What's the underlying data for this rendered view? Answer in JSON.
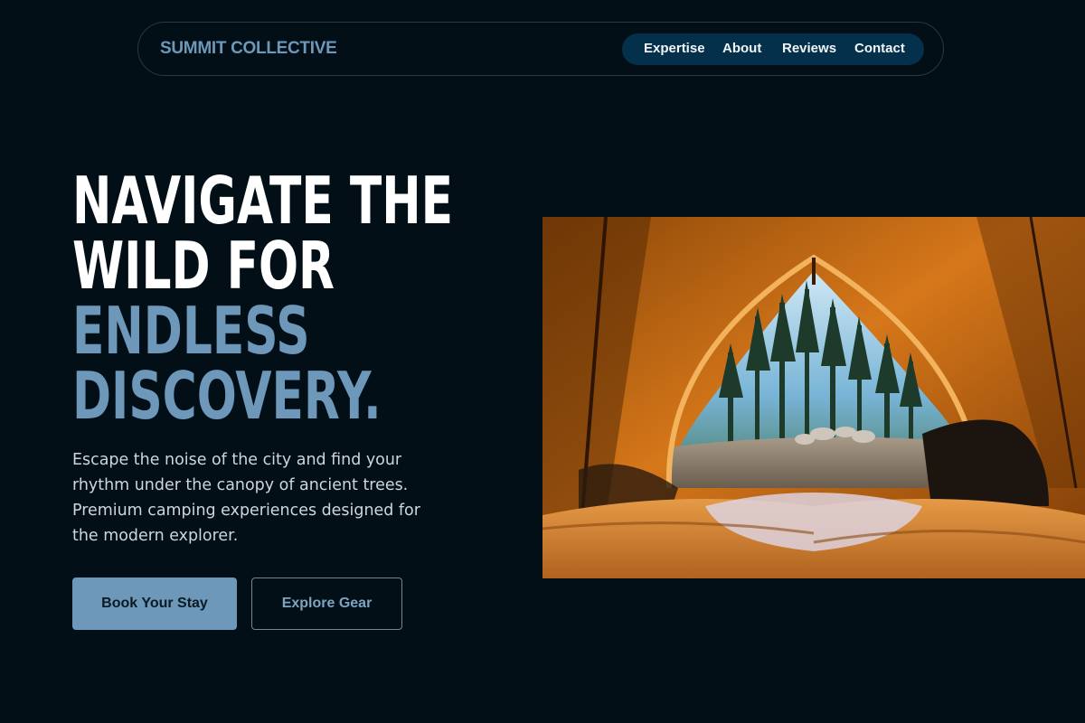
{
  "nav": {
    "brand": "SUMMIT COLLECTIVE",
    "links": [
      {
        "label": "Expertise"
      },
      {
        "label": "About"
      },
      {
        "label": "Reviews"
      },
      {
        "label": "Contact"
      }
    ]
  },
  "hero": {
    "title_line1": "NAVIGATE THE",
    "title_line2": "WILD FOR",
    "title_accent_line1": "ENDLESS",
    "title_accent_line2": "DISCOVERY.",
    "description": "Escape the noise of the city and find your rhythm under the canopy of ancient trees. Premium camping experiences designed for the modern explorer.",
    "primary_button": "Book Your Stay",
    "secondary_button": "Explore Gear",
    "image_icon": "tent-view-photo"
  },
  "colors": {
    "background": "#020f17",
    "accent": "#6d98b9",
    "nav_pill": "#05304b"
  }
}
